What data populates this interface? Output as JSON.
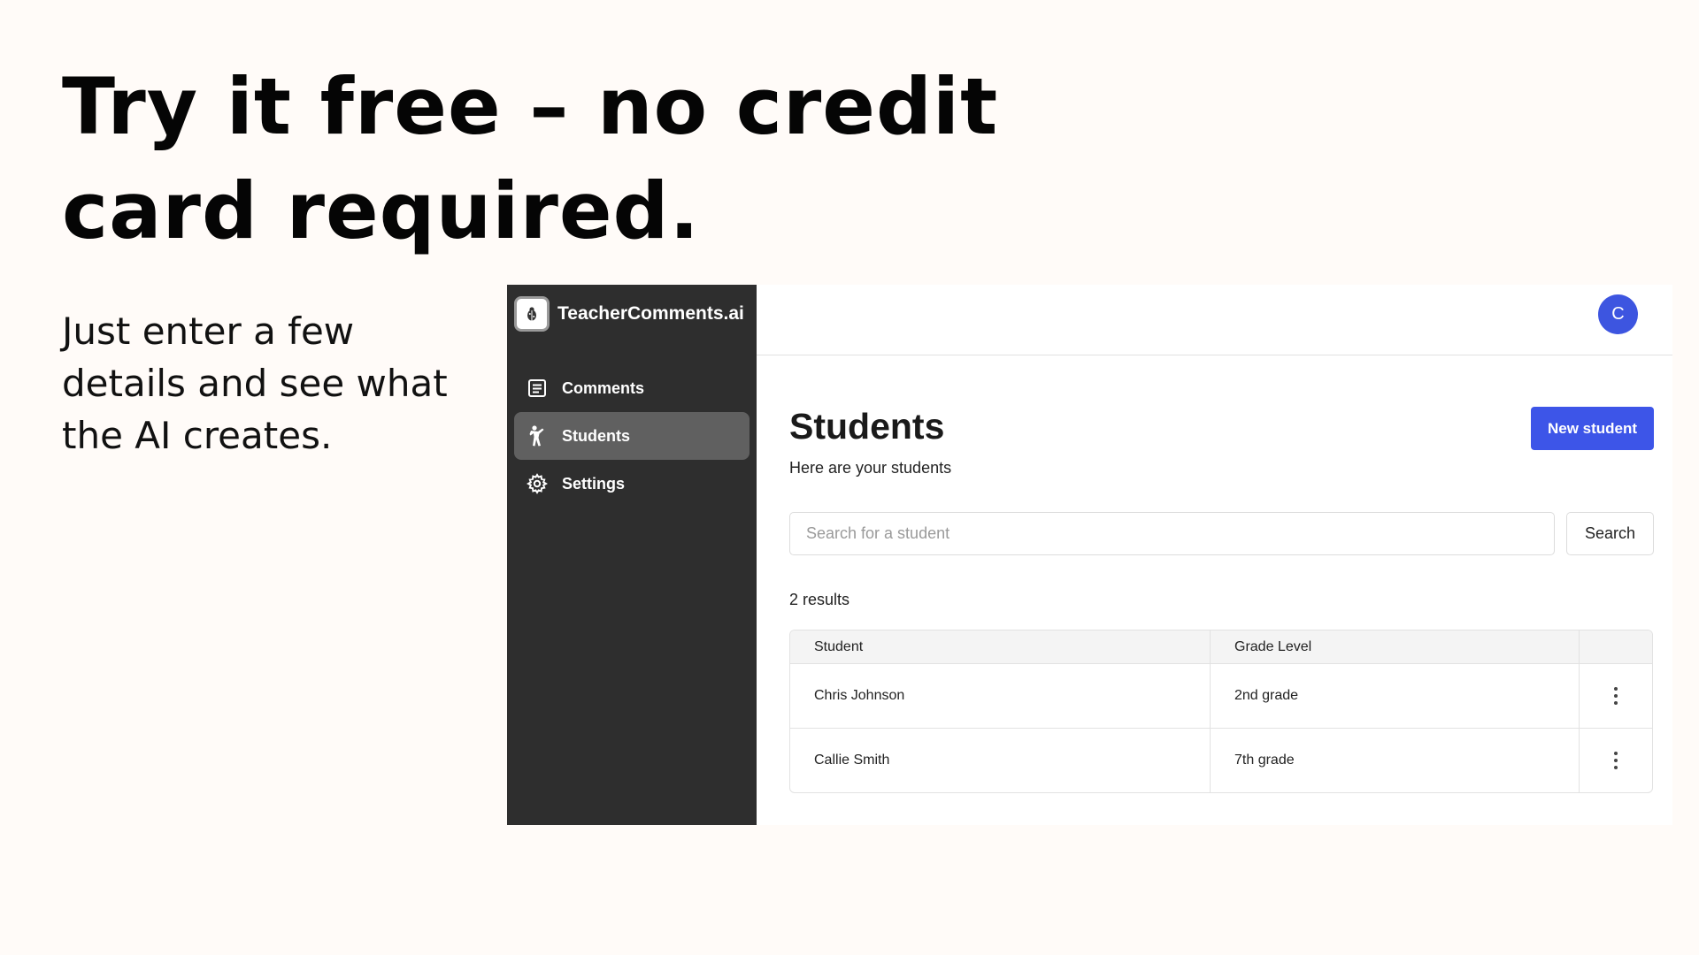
{
  "slide": {
    "headline": "Try it free – no credit card required.",
    "subtext": "Just enter a few details and see what the AI creates."
  },
  "app": {
    "brand": {
      "name": "TeacherComments.ai",
      "logo_icon": "ladybug-icon"
    },
    "sidebar": {
      "items": [
        {
          "label": "Comments",
          "icon": "document-list-icon",
          "active": false
        },
        {
          "label": "Students",
          "icon": "person-icon",
          "active": true
        },
        {
          "label": "Settings",
          "icon": "gear-icon",
          "active": false
        }
      ]
    },
    "user": {
      "avatar_initial": "C",
      "avatar_color": "#3d55e0"
    },
    "page": {
      "title": "Students",
      "subtitle": "Here are your students",
      "new_button_label": "New student"
    },
    "search": {
      "placeholder": "Search for a student",
      "value": "",
      "button_label": "Search"
    },
    "results": {
      "count_text": "2 results",
      "columns": [
        "Student",
        "Grade Level",
        ""
      ],
      "rows": [
        {
          "student": "Chris Johnson",
          "grade_level": "2nd grade"
        },
        {
          "student": "Callie Smith",
          "grade_level": "7th grade"
        }
      ]
    },
    "colors": {
      "accent": "#3d55e8",
      "sidebar_bg": "#2e2e2e",
      "sidebar_active_bg": "#606060",
      "page_bg": "#fffbf8"
    }
  }
}
